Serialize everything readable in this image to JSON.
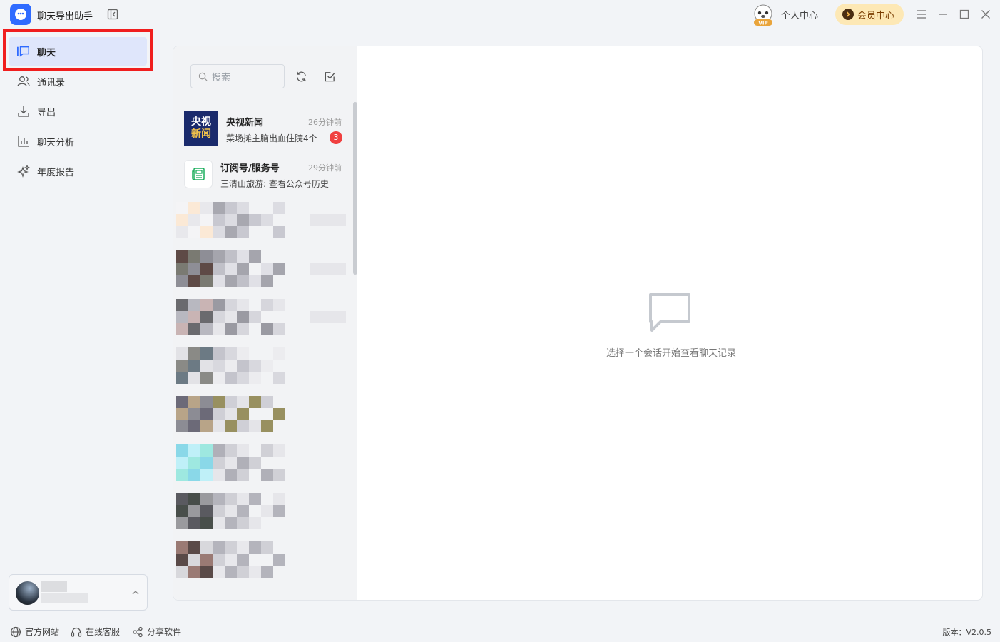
{
  "app": {
    "title": "聊天导出助手"
  },
  "header": {
    "personal_center": "个人中心",
    "member_center": "会员中心",
    "vip_badge": "VIP"
  },
  "sidebar": {
    "items": [
      {
        "label": "聊天",
        "icon": "chat-bubble-icon",
        "active": true
      },
      {
        "label": "通讯录",
        "icon": "contacts-icon",
        "active": false
      },
      {
        "label": "导出",
        "icon": "download-icon",
        "active": false
      },
      {
        "label": "聊天分析",
        "icon": "bar-chart-icon",
        "active": false
      },
      {
        "label": "年度报告",
        "icon": "sparkle-icon",
        "active": false
      }
    ]
  },
  "chat_list": {
    "search_placeholder": "搜索",
    "conversations": [
      {
        "name": "央视新闻",
        "logo_text_1": "央视",
        "logo_text_2": "新闻",
        "time": "26分钟前",
        "preview": "菜场摊主脑出血住院4个",
        "unread": "3"
      },
      {
        "name": "订阅号/服务号",
        "time": "29分钟前",
        "preview": "三清山旅游: 查看公众号历史"
      }
    ]
  },
  "empty_state": {
    "message": "选择一个会话开始查看聊天记录"
  },
  "footer": {
    "official_site": "官方网站",
    "online_support": "在线客服",
    "share": "分享软件",
    "version": "版本：V2.0.5"
  },
  "colors": {
    "accent": "#2f6bff",
    "highlight": "#f01e1e",
    "badge": "#f04040"
  }
}
